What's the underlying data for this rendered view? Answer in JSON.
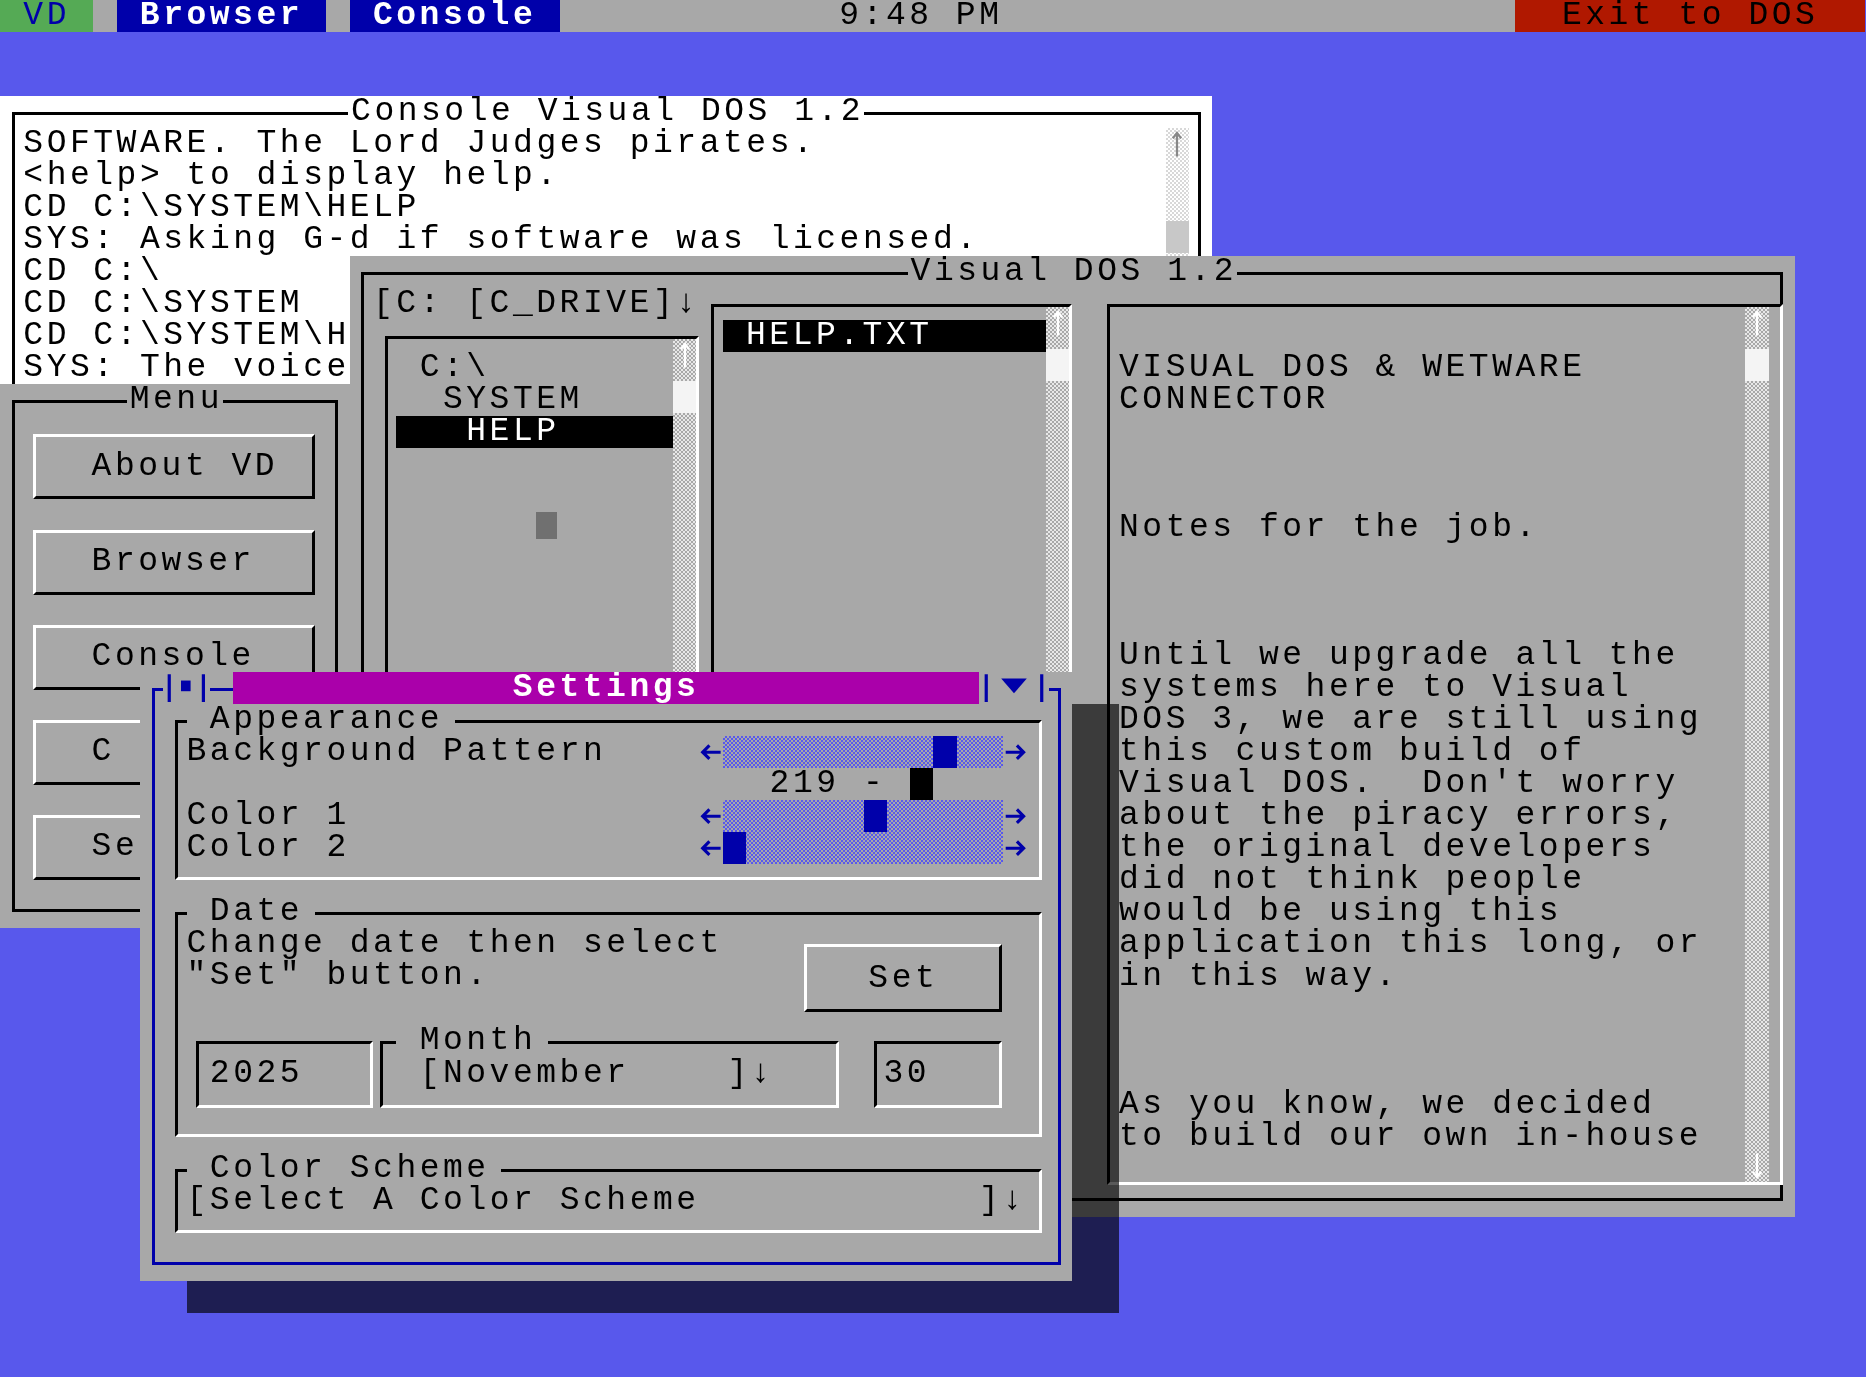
{
  "top_bar": {
    "logo": "VD",
    "tabs": [
      {
        "label": "Browser"
      },
      {
        "label": "Console"
      }
    ],
    "clock": "9:48 PM",
    "exit_button": "Exit to DOS"
  },
  "console_window": {
    "title": "Console Visual DOS 1.2",
    "lines": [
      "SOFTWARE. The Lord Judges pirates.",
      "<help> to display help.",
      "CD C:\\SYSTEM\\HELP",
      "SYS: Asking G-d if software was licensed.",
      "CD C:\\",
      "CD C:\\SYSTEM",
      "CD C:\\SYSTEM\\H",
      "SYS: The voice"
    ]
  },
  "menu_window": {
    "title": "Menu",
    "buttons": [
      "About VD",
      "Browser",
      "Console",
      "C",
      "Se"
    ]
  },
  "browser_window": {
    "title": "Visual DOS 1.2",
    "drive_dropdown": "[C: [C_DRIVE]↓",
    "folder_tree": [
      {
        "label": "C:\\",
        "selected": false,
        "children": [
          {
            "label": "SYSTEM",
            "selected": false,
            "children": [
              {
                "label": "HELP",
                "selected": true
              }
            ]
          }
        ]
      }
    ],
    "files": [
      {
        "name": "HELP.TXT",
        "selected": true
      }
    ],
    "document": [
      {
        "lines": [
          "VISUAL DOS & WETWARE",
          "CONNECTOR"
        ]
      },
      {
        "lines": [
          "Notes for the job."
        ]
      },
      {
        "lines": [
          "Until we upgrade all the",
          "systems here to Visual",
          "DOS 3, we are still using",
          "this custom build of",
          "Visual DOS.  Don't worry",
          "about the piracy errors,",
          "the original developers",
          "did not think people",
          "would be using this",
          "application this long, or",
          "in this way."
        ]
      },
      {
        "lines": [
          "As you know, we decided",
          "to build our own in-house"
        ]
      }
    ]
  },
  "settings_dialog": {
    "title": "Settings",
    "appearance": {
      "title": "Appearance",
      "rows": [
        {
          "kind": "slider",
          "label": "Background Pattern",
          "level": 0.82
        },
        {
          "kind": "reading",
          "value": "219 -"
        },
        {
          "kind": "slider",
          "label": "Color 1",
          "level": 0.55
        },
        {
          "kind": "slider",
          "label": "Color 2",
          "level": 0
        }
      ]
    },
    "date": {
      "title": "Date",
      "instructions": "Change date then select \"Set\" button.",
      "set_button": "Set",
      "year": "2025",
      "month_label": "Month",
      "month": "[November",
      "month_toggle": "]↓",
      "day": "30"
    },
    "color_scheme": {
      "title": "Color Scheme",
      "value": "[Select A Color Scheme",
      "toggle": "]↓"
    }
  }
}
